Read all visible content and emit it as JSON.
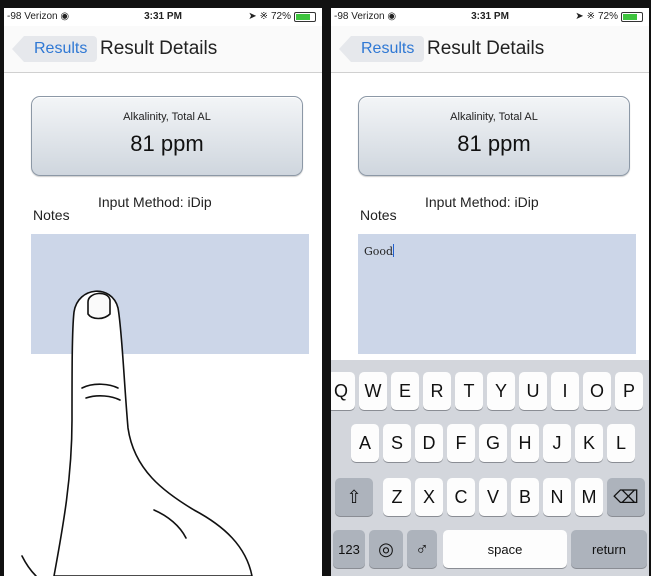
{
  "status_bar": {
    "carrier": "-98 Verizon",
    "time": "3:31 PM",
    "battery": "72%"
  },
  "nav": {
    "back_label": "Results",
    "title": "Result Details"
  },
  "result": {
    "name": "Alkalinity, Total AL",
    "value": "81 ppm"
  },
  "input_method": "Input Method: iDip",
  "notes": {
    "label": "Notes",
    "left_value": "",
    "right_value": "Good"
  },
  "keyboard": {
    "row1": [
      "Q",
      "W",
      "E",
      "R",
      "T",
      "Y",
      "U",
      "I",
      "O",
      "P"
    ],
    "row2": [
      "A",
      "S",
      "D",
      "F",
      "G",
      "H",
      "J",
      "K",
      "L"
    ],
    "row3": [
      "Z",
      "X",
      "C",
      "V",
      "B",
      "N",
      "M"
    ],
    "numbers_key": "123",
    "space_key": "space",
    "return_key": "return"
  },
  "icons": {
    "shift": "shift-icon",
    "delete": "delete-icon",
    "globe": "globe-icon",
    "mic": "microphone-icon",
    "wifi": "wifi-icon",
    "bluetooth": "bluetooth-icon",
    "location": "location-arrow-icon"
  },
  "colors": {
    "accent": "#2f78d4",
    "notes_bg": "#ccd6e8",
    "keyboard_bg": "#d3d6dc",
    "battery": "#3ec43e"
  }
}
